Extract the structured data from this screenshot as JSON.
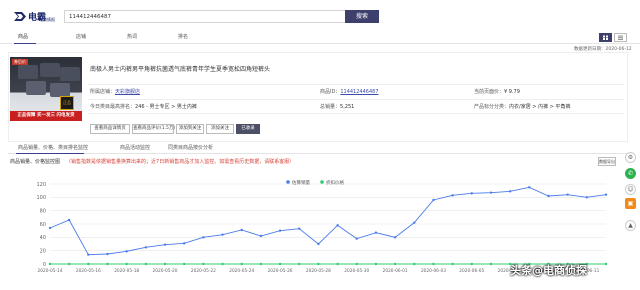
{
  "header": {
    "logo_text": "电霸",
    "logo_sub": "电商情报",
    "search_value": "114412446487",
    "search_button": "搜索"
  },
  "nav": {
    "tabs": [
      {
        "label": "商品",
        "active": true
      },
      {
        "label": "店铺",
        "active": false
      },
      {
        "label": "热词",
        "active": false
      },
      {
        "label": "排名",
        "active": false
      }
    ]
  },
  "update_date": "数据更新日期：2020-06-12",
  "product": {
    "title": "南极人男士内裤男平角裤抗菌透气底裤青年学生夏季宽松四角短裤头",
    "thumb_tag": "券后价",
    "thumb_banner": "正品保障 买一发三 闪电发货",
    "thumb_badge": "正品",
    "info": {
      "brand_label": "所属店铺：",
      "brand_value": "天彩旗舰店",
      "product_id_label": "商品ID：",
      "product_id_value": "114412446487",
      "price_label": "当前页面价：",
      "price_value": "¥ 9.79",
      "category_label": "今日类目最高排名：",
      "category_value": "246 - 男士专区 > 男士内裤",
      "reviews_label": "总销量：",
      "reviews_value": "5,251",
      "attr_label": "产品标分分类：",
      "attr_value": "内衣/家居 > 内裤 > 平角裤"
    },
    "actions": [
      {
        "label": "查看商品详情页",
        "dark": false
      },
      {
        "label": "查看商品评价(1.5万)",
        "dark": false
      },
      {
        "label": "添加到关注",
        "dark": false
      },
      {
        "label": "添加关注",
        "dark": false
      },
      {
        "label": "已收录",
        "dark": true
      }
    ]
  },
  "subtabs": [
    "商品销量、价格、类目排名监控",
    "商品活动监控",
    "同类目商品按价分析"
  ],
  "sales": {
    "title": "商品销量、价格监控图",
    "hint": "（销售指数是依据销售量换算出来的；近7日新销售商品才加入监控。如需查看历史数据，请联系客服）",
    "export_label": "数据导出"
  },
  "chart_data": {
    "type": "line",
    "x": [
      "2020-05-14",
      "2020-05-15",
      "2020-05-16",
      "2020-05-17",
      "2020-05-18",
      "2020-05-19",
      "2020-05-20",
      "2020-05-21",
      "2020-05-22",
      "2020-05-23",
      "2020-05-24",
      "2020-05-25",
      "2020-05-26",
      "2020-05-27",
      "2020-05-28",
      "2020-05-29",
      "2020-05-30",
      "2020-05-31",
      "2020-06-01",
      "2020-06-02",
      "2020-06-03",
      "2020-06-04",
      "2020-06-05",
      "2020-06-06",
      "2020-06-07",
      "2020-06-08",
      "2020-06-09",
      "2020-06-10",
      "2020-06-11",
      "2020-06-12"
    ],
    "x_tick_labels": [
      "2020-05-14",
      "2020-05-16",
      "2020-05-18",
      "2020-05-20",
      "2020-05-22",
      "2020-05-24",
      "2020-05-26",
      "2020-05-28",
      "2020-05-30",
      "2020-06-01",
      "2020-06-03",
      "2020-06-05",
      "2020-06-07",
      "2020-06-09",
      "2020-06-11"
    ],
    "series": [
      {
        "name": "估算销量",
        "color": "#4b7bec",
        "values": [
          54,
          66,
          14,
          15,
          19,
          25,
          29,
          31,
          40,
          44,
          51,
          42,
          50,
          53,
          30,
          58,
          38,
          47,
          40,
          62,
          96,
          103,
          106,
          107,
          109,
          115,
          102,
          104,
          100,
          104
        ]
      },
      {
        "name": "折扣价格",
        "color": "#2ecc71",
        "values": [
          0,
          0,
          0,
          0,
          0,
          0,
          0,
          0,
          0,
          0,
          0,
          0,
          0,
          0,
          0,
          0,
          0,
          0,
          0,
          0,
          0,
          0,
          0,
          0,
          0,
          0,
          0,
          0,
          0,
          0
        ]
      }
    ],
    "ylim": [
      0,
      120
    ],
    "yticks": [
      0,
      20,
      40,
      60,
      80,
      100,
      120
    ],
    "legend": "top-center",
    "grid": true
  },
  "side_icons": [
    "setting-icon",
    "wechat-icon",
    "qq-icon",
    "gift-icon",
    "top-icon"
  ],
  "watermark": "头条@电商侦探"
}
